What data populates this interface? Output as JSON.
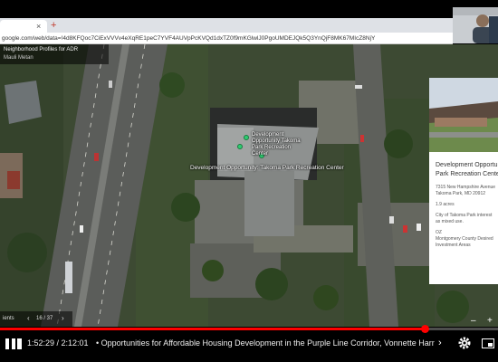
{
  "browser": {
    "new_tab_symbol": "+",
    "tab_close_symbol": "×",
    "url": "google.com/web/data=!4d8KFQoc7CiExVVVv4eXqRE1peC7YVF4AUVpPcKVQd1dxTZ0f9mKGlwlJ0PgoUMDEJQk5Q3YnQjF8MK67MIcZ8NjY"
  },
  "map": {
    "overlay_line1": "Neighborhood Profiles for ADR",
    "overlay_line2": "Mauli Metan",
    "place_label": "Development Opportunity: Takoma Park Recreation Center",
    "building_label": "Development Opportunity Takoma Park Recreation Center"
  },
  "info_panel": {
    "title_line1": "Development Opportu",
    "title_line2": "Park Recreation Cente",
    "address_line1": "7315 New Hampshire Avenue",
    "address_line2": "Takoma Park, MD 20912",
    "acreage": "1.9 acres",
    "note_line1": "City of Takoma Park interest",
    "note_line2": "as mixed use.",
    "oz_label": "OZ",
    "designation_line1": "Montgomery County Desired",
    "designation_line2": "Investment Areas"
  },
  "slide_nav": {
    "label": "ients",
    "prev_symbol": "‹",
    "counter": "16 / 37",
    "next_symbol": "›"
  },
  "map_zoom": {
    "zoom_out": "–",
    "zoom_in": "+"
  },
  "player": {
    "current_time": "1:52:29",
    "duration": "2:12:01",
    "time_display": "1:52:29 / 2:12:01",
    "title": "• Opportunities for Affordable Housing Development in the Purple Line Corridor, Vonnette Harri...",
    "progress_fraction": 0.852,
    "chevron_symbol": "›"
  },
  "colors": {
    "progress": "#ff0000",
    "pin": "#2ecc71"
  }
}
